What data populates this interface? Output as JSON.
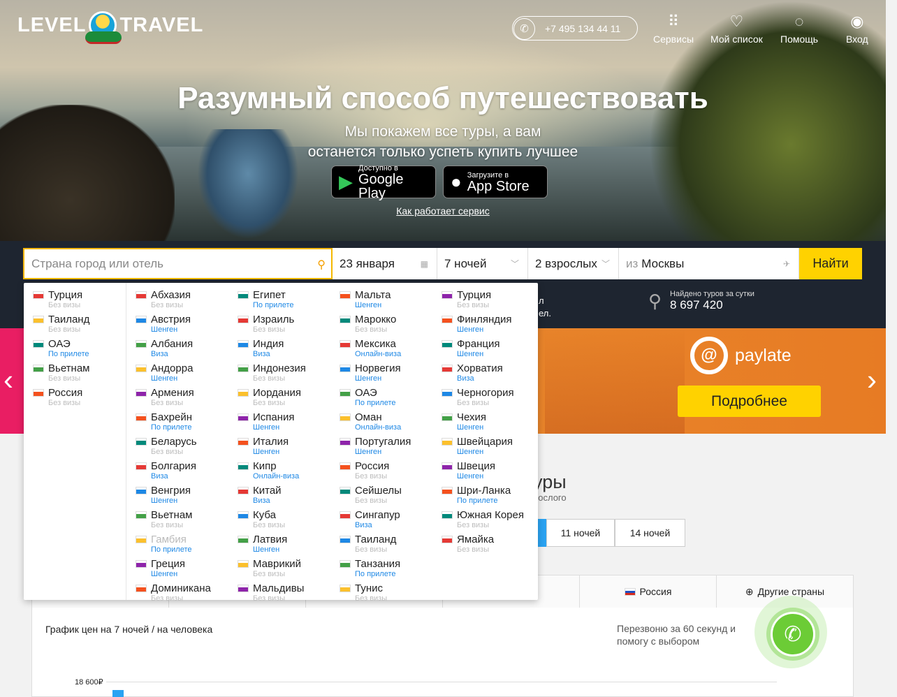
{
  "header": {
    "logo_left": "LEVEL",
    "logo_right": "TRAVEL",
    "phone": "+7 495 134 44 11",
    "nav": [
      {
        "label": "Сервисы",
        "icon": "grid-icon"
      },
      {
        "label": "Мой список",
        "icon": "heart-icon"
      },
      {
        "label": "Помощь",
        "icon": "bulb-icon"
      },
      {
        "label": "Вход",
        "icon": "user-icon"
      }
    ]
  },
  "hero": {
    "title": "Разумный способ путешествовать",
    "subtitle1": "Мы покажем все туры, а вам",
    "subtitle2": "останется только успеть купить лучшее",
    "google_small": "Доступно в",
    "google_big": "Google Play",
    "apple_small": "Загрузите в",
    "apple_big": "App Store",
    "how": "Как работает сервис"
  },
  "search": {
    "placeholder": "Страна город или отель",
    "date": "23 января",
    "nights": "7 ночей",
    "guests": "2 взрослых",
    "from_prefix": "из",
    "from_city": "Москвы",
    "button": "Найти",
    "stat_label": "Найдено туров за сутки",
    "stat_value": "8 697 420",
    "partial_line1": "л",
    "partial_line2": "ел."
  },
  "banner": {
    "brand": "paylate",
    "button": "Подробнее"
  },
  "section": {
    "title_partial": "уры",
    "subtitle_partial": "рослого",
    "night_tabs": [
      "11 ночей",
      "14 ночей"
    ]
  },
  "country_tabs": [
    "Россия",
    "Другие страны"
  ],
  "chart": {
    "title": "График цен на 7 ночей / на человека",
    "callback": "Перезвоню за 60 секунд и помогу с выбором"
  },
  "chart_data": {
    "type": "bar",
    "ylabel": "",
    "y_ticks": [
      "18 600₽"
    ],
    "values": [],
    "categories": []
  },
  "colors": {
    "visa_free": "#bdbdbd",
    "visa_blue": "#1e88e5",
    "accent": "#ffd200"
  },
  "popular": [
    {
      "name": "Турция",
      "visa": "Без визы",
      "t": "g"
    },
    {
      "name": "Таиланд",
      "visa": "Без визы",
      "t": "g"
    },
    {
      "name": "ОАЭ",
      "visa": "По прилете",
      "t": "b"
    },
    {
      "name": "Вьетнам",
      "visa": "Без визы",
      "t": "g"
    },
    {
      "name": "Россия",
      "visa": "Без визы",
      "t": "g"
    }
  ],
  "countries": [
    [
      {
        "name": "Абхазия",
        "visa": "Без визы",
        "t": "g"
      },
      {
        "name": "Австрия",
        "visa": "Шенген",
        "t": "b"
      },
      {
        "name": "Албания",
        "visa": "Виза",
        "t": "b"
      },
      {
        "name": "Андорра",
        "visa": "Шенген",
        "t": "b"
      },
      {
        "name": "Армения",
        "visa": "Без визы",
        "t": "g"
      },
      {
        "name": "Бахрейн",
        "visa": "По прилете",
        "t": "b"
      },
      {
        "name": "Беларусь",
        "visa": "Без визы",
        "t": "g"
      },
      {
        "name": "Болгария",
        "visa": "Виза",
        "t": "b"
      },
      {
        "name": "Венгрия",
        "visa": "Шенген",
        "t": "b"
      },
      {
        "name": "Вьетнам",
        "visa": "Без визы",
        "t": "g"
      },
      {
        "name": "Гамбия",
        "visa": "По прилете",
        "t": "b",
        "dis": true
      },
      {
        "name": "Греция",
        "visa": "Шенген",
        "t": "b"
      },
      {
        "name": "Доминикана",
        "visa": "Без визы",
        "t": "g"
      }
    ],
    [
      {
        "name": "Египет",
        "visa": "По прилете",
        "t": "b"
      },
      {
        "name": "Израиль",
        "visa": "Без визы",
        "t": "g"
      },
      {
        "name": "Индия",
        "visa": "Виза",
        "t": "b"
      },
      {
        "name": "Индонезия",
        "visa": "Без визы",
        "t": "g"
      },
      {
        "name": "Иордания",
        "visa": "Без визы",
        "t": "g"
      },
      {
        "name": "Испания",
        "visa": "Шенген",
        "t": "b"
      },
      {
        "name": "Италия",
        "visa": "Шенген",
        "t": "b"
      },
      {
        "name": "Кипр",
        "visa": "Онлайн-виза",
        "t": "b"
      },
      {
        "name": "Китай",
        "visa": "Виза",
        "t": "b"
      },
      {
        "name": "Куба",
        "visa": "Без визы",
        "t": "g"
      },
      {
        "name": "Латвия",
        "visa": "Шенген",
        "t": "b"
      },
      {
        "name": "Маврикий",
        "visa": "Без визы",
        "t": "g"
      },
      {
        "name": "Мальдивы",
        "visa": "Без визы",
        "t": "g"
      }
    ],
    [
      {
        "name": "Мальта",
        "visa": "Шенген",
        "t": "b"
      },
      {
        "name": "Марокко",
        "visa": "Без визы",
        "t": "g"
      },
      {
        "name": "Мексика",
        "visa": "Онлайн-виза",
        "t": "b"
      },
      {
        "name": "Норвегия",
        "visa": "Шенген",
        "t": "b"
      },
      {
        "name": "ОАЭ",
        "visa": "По прилете",
        "t": "b"
      },
      {
        "name": "Оман",
        "visa": "Онлайн-виза",
        "t": "b"
      },
      {
        "name": "Португалия",
        "visa": "Шенген",
        "t": "b"
      },
      {
        "name": "Россия",
        "visa": "Без визы",
        "t": "g"
      },
      {
        "name": "Сейшелы",
        "visa": "Без визы",
        "t": "g"
      },
      {
        "name": "Сингапур",
        "visa": "Виза",
        "t": "b"
      },
      {
        "name": "Таиланд",
        "visa": "Без визы",
        "t": "g"
      },
      {
        "name": "Танзания",
        "visa": "По прилете",
        "t": "b"
      },
      {
        "name": "Тунис",
        "visa": "Без визы",
        "t": "g"
      }
    ],
    [
      {
        "name": "Турция",
        "visa": "Без визы",
        "t": "g"
      },
      {
        "name": "Финляндия",
        "visa": "Шенген",
        "t": "b"
      },
      {
        "name": "Франция",
        "visa": "Шенген",
        "t": "b"
      },
      {
        "name": "Хорватия",
        "visa": "Виза",
        "t": "b"
      },
      {
        "name": "Черногория",
        "visa": "Без визы",
        "t": "g"
      },
      {
        "name": "Чехия",
        "visa": "Шенген",
        "t": "b"
      },
      {
        "name": "Швейцария",
        "visa": "Шенген",
        "t": "b"
      },
      {
        "name": "Швеция",
        "visa": "Шенген",
        "t": "b"
      },
      {
        "name": "Шри-Ланка",
        "visa": "По прилете",
        "t": "b"
      },
      {
        "name": "Южная Корея",
        "visa": "Без визы",
        "t": "g"
      },
      {
        "name": "Ямайка",
        "visa": "Без визы",
        "t": "g"
      }
    ]
  ]
}
